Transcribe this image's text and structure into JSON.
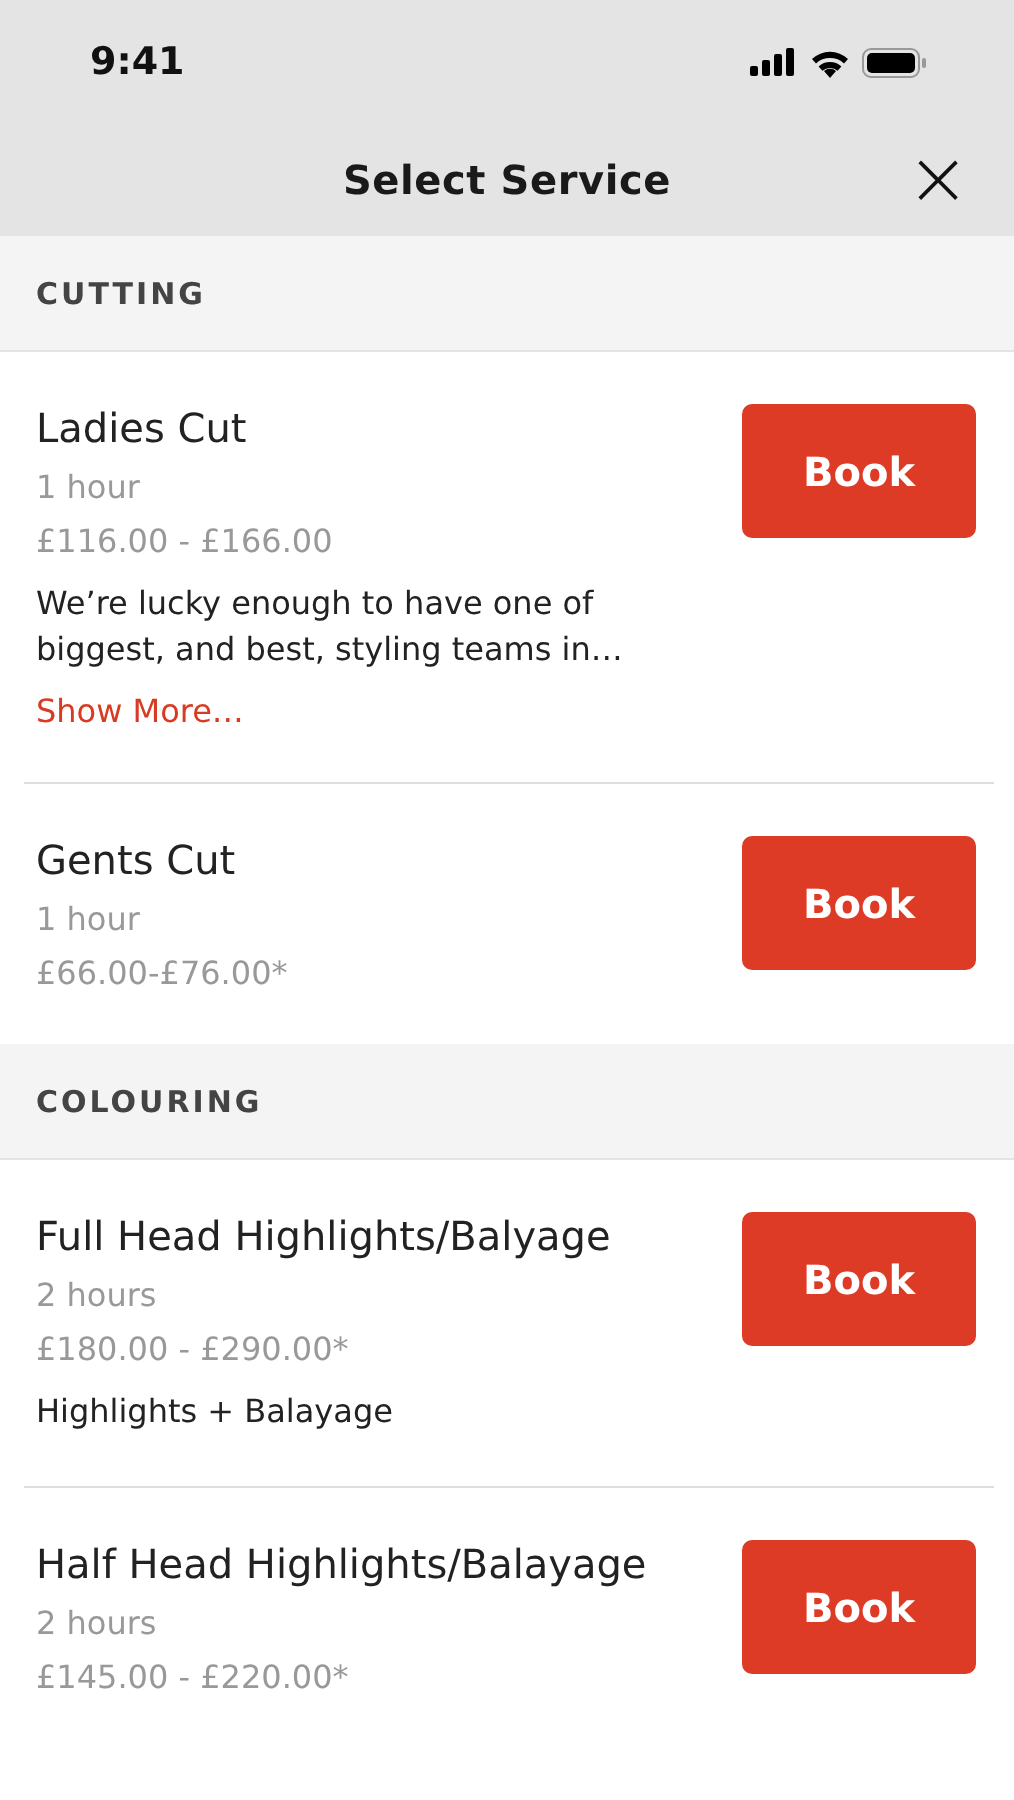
{
  "status_bar": {
    "time": "9:41"
  },
  "header": {
    "title": "Select Service",
    "close": "×"
  },
  "sections": [
    {
      "title": "CUTTING",
      "items": [
        {
          "name": "Ladies Cut",
          "duration": "1 hour",
          "price": "£116.00 - £166.00",
          "description": "We’re lucky enough to have one of biggest, and best, styling teams in…",
          "link": "Show More…",
          "button": "Book"
        },
        {
          "name": "Gents Cut",
          "duration": "1 hour",
          "price": "£66.00-£76.00*",
          "button": "Book"
        }
      ]
    },
    {
      "title": "COLOURING",
      "items": [
        {
          "name": "Full Head Highlights/Balyage",
          "duration": "2 hours",
          "price": "£180.00 - £290.00*",
          "description": "Highlights + Balayage",
          "button": "Book"
        },
        {
          "name": "Half Head Highlights/Balayage",
          "duration": "2 hours",
          "price": "£145.00 - £220.00*",
          "button": "Book"
        }
      ]
    }
  ]
}
